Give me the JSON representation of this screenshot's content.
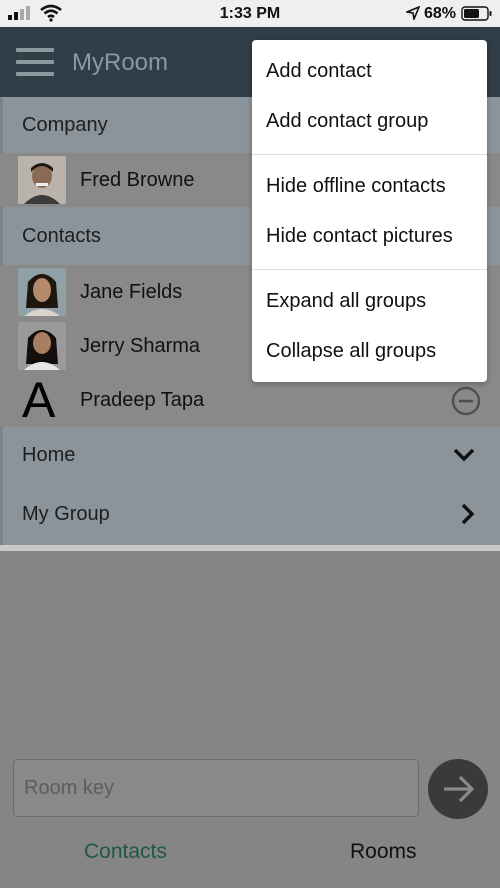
{
  "status_bar": {
    "time": "1:33 PM",
    "battery_percent": "68%",
    "battery_level": 0.68
  },
  "header": {
    "title": "MyRoom"
  },
  "groups": {
    "company": {
      "label": "Company"
    },
    "contacts": {
      "label": "Contacts"
    },
    "home": {
      "label": "Home"
    },
    "my_group": {
      "label": "My Group"
    }
  },
  "contacts": [
    {
      "name": "Fred Browne"
    },
    {
      "name": "Jane Fields"
    },
    {
      "name": "Jerry Sharma"
    },
    {
      "name": "Pradeep Tapa",
      "initial": "A"
    }
  ],
  "room_key": {
    "placeholder": "Room key"
  },
  "tabs": {
    "contacts": "Contacts",
    "rooms": "Rooms"
  },
  "menu": {
    "items": [
      "Add contact",
      "Add contact group",
      "Hide offline contacts",
      "Hide contact pictures",
      "Expand all groups",
      "Collapse all groups"
    ]
  },
  "colors": {
    "header_bg": "#2f3e48",
    "active_tab": "#1f5a40"
  }
}
